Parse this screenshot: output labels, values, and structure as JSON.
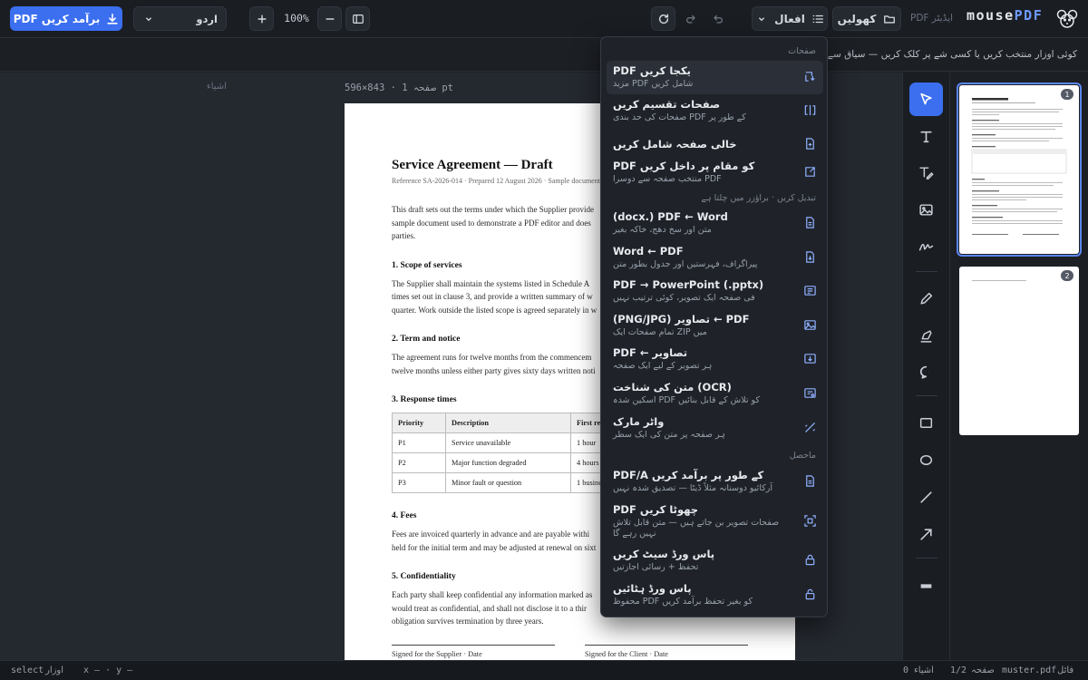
{
  "toolbar": {
    "export_label": "PDF برآمد کریں",
    "language": "اردو",
    "zoom": "100%",
    "actions_label": "افعال",
    "open_label": "کھولیں",
    "brand_sub": "PDF ایڈیٹر",
    "brand_main": "mouse",
    "brand_accent": "PDF"
  },
  "hint": "کوئی اوزار منتخب کریں یا کسی شے پر کلک کریں — سیاق سے متعلق",
  "canvas": {
    "side_label": "اشیاء",
    "page_meta": "صفحہ 1 · 843×596 pt"
  },
  "document": {
    "title": "Service Agreement — Draft",
    "reference": "Reference SA-2026-014 · Prepared 12 August 2026 · Sample document",
    "intro": [
      "This draft sets out the terms under which the Supplier provide",
      "sample document used to demonstrate a PDF editor and does",
      "parties."
    ],
    "s1_heading": "1. Scope of services",
    "s1": [
      "The Supplier shall maintain the systems listed in Schedule A",
      "times set out in clause 3, and provide a written summary of w",
      "quarter. Work outside the listed scope is agreed separately in w"
    ],
    "s2_heading": "2. Term and notice",
    "s2": [
      "The agreement runs for twelve months from the commencem",
      "twelve months unless either party gives sixty days written noti"
    ],
    "s3_heading": "3. Response times",
    "table": {
      "headers": [
        "Priority",
        "Description",
        "First re"
      ],
      "rows": [
        [
          "P1",
          "Service unavailable",
          "1 hour"
        ],
        [
          "P2",
          "Major function degraded",
          "4 hours"
        ],
        [
          "P3",
          "Minor fault or question",
          "1 busine"
        ]
      ]
    },
    "s4_heading": "4. Fees",
    "s4": [
      "Fees are invoiced quarterly in advance and are payable withi",
      "held for the initial term and may be adjusted at renewal on sixt"
    ],
    "s5_heading": "5. Confidentiality",
    "s5": [
      "Each party shall keep confidential any information marked as",
      "would treat as confidential, and shall not disclose it to a thir",
      "obligation survives termination by three years."
    ],
    "sig_supplier": "Signed for the Supplier · Date",
    "sig_client": "Signed for the Client · Date"
  },
  "thumbnails": [
    {
      "number": "1"
    },
    {
      "number": "2"
    }
  ],
  "tools": [
    "select-tool",
    "text-tool",
    "edit-text-tool",
    "image-tool",
    "signature-tool",
    "pen-tool",
    "highlighter-tool",
    "comment-tool",
    "rectangle-tool",
    "ellipse-tool",
    "line-tool",
    "arrow-tool",
    "redact-tool"
  ],
  "menu": {
    "sections": {
      "pages": "صفحات",
      "convert": "تبدیل کریں · براؤزر میں چلتا ہے",
      "output": "ماحصل"
    },
    "items": [
      {
        "title": "PDF یکجا کریں",
        "sub": "مزید PDF شامل کریں",
        "icon": "merge-icon"
      },
      {
        "title": "صفحات تقسیم کریں",
        "sub": "صفحات کی حد بندی PDF کے طور پر",
        "icon": "split-icon"
      },
      {
        "title": "خالی صفحہ شامل کریں",
        "sub": "",
        "icon": "add-page-icon"
      },
      {
        "title": "PDF کو مقام پر داخل کریں",
        "sub": "منتخب صفحہ سے دوسرا PDF",
        "icon": "insert-icon"
      },
      {
        "title": "(docx.) PDF ← Word",
        "sub": "متن اور سخ دهج، خاکہ بغیر",
        "icon": "word-icon"
      },
      {
        "title": "Word ← PDF",
        "sub": "پیراگراف، فہرستیں اور جدول بطور متن",
        "icon": "word-out-icon"
      },
      {
        "title": "PDF → PowerPoint (.pptx)",
        "sub": "فی صفحہ ایک تصویر، کوئی ترتیب نہیں",
        "icon": "slides-icon"
      },
      {
        "title": "(PNG/JPG) تصاویر ← PDF",
        "sub": "تمام صفحات ایک ZIP میں",
        "icon": "image-export-icon"
      },
      {
        "title": "PDF ← تصاویر",
        "sub": "ہر تصویر کے لیے ایک صفحہ",
        "icon": "image-import-icon"
      },
      {
        "title": "متن کی شناخت (OCR)",
        "sub": "اسکین شدہ PDF کو تلاش کے قابل بنائیں",
        "icon": "ocr-icon"
      },
      {
        "title": "واٹر مارک",
        "sub": "ہر صفحہ پر متن کی ایک سطر",
        "icon": "watermark-icon"
      },
      {
        "title": "PDF/A کے طور پر برآمد کریں",
        "sub": "آرکائیو دوستانہ مثلاً ڈیٹا — تصدیق شدہ نہیں",
        "icon": "archive-icon"
      },
      {
        "title": "PDF چھوٹا کریں",
        "sub": "صفحات تصویر بن جاتے ہیں — متن قابل تلاش نہیں رہے گا",
        "icon": "compress-icon"
      },
      {
        "title": "پاس ورڈ سیٹ کریں",
        "sub": "تحفظ + رسائی اجازتیں",
        "icon": "lock-icon"
      },
      {
        "title": "پاس ورڈ ہٹائیں",
        "sub": "محفوظ PDF کو بغیر تحفظ برآمد کریں",
        "icon": "unlock-icon"
      }
    ]
  },
  "status": {
    "file_label": "فائل",
    "file_name": "muster.pdf",
    "page_label": "صفحہ",
    "page_value": "1/2",
    "objects_label": "اشیاء",
    "objects_value": "0",
    "coords": "x — · y —",
    "tool_label": "اوزار",
    "tool_value": "select"
  }
}
